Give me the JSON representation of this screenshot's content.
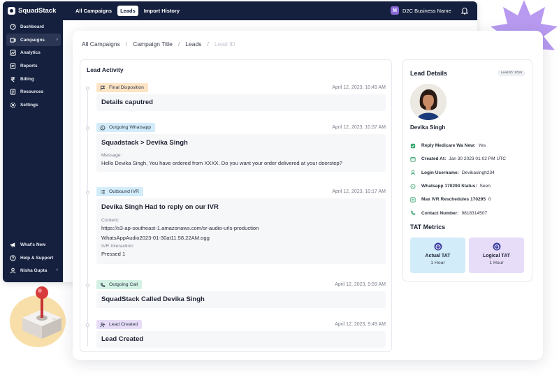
{
  "app": {
    "brand": "SquadStack",
    "top_tabs": [
      "All Campaigns",
      "Leads",
      "Import History"
    ],
    "active_tab": "Leads",
    "business": {
      "badge": "M",
      "name": "D2C Business Name"
    }
  },
  "sidebar": {
    "items": [
      {
        "label": "Dashboard",
        "icon": "dashboard-icon"
      },
      {
        "label": "Campaigns",
        "icon": "campaigns-icon",
        "active": true,
        "chevron": "›"
      },
      {
        "label": "Analytics",
        "icon": "analytics-icon"
      },
      {
        "label": "Reports",
        "icon": "reports-icon"
      },
      {
        "label": "Billing",
        "icon": "rupee-icon"
      },
      {
        "label": "Resources",
        "icon": "resources-icon"
      },
      {
        "label": "Settings",
        "icon": "gear-icon"
      }
    ],
    "bottom": [
      {
        "label": "What's New",
        "icon": "megaphone-icon"
      },
      {
        "label": "Help & Support",
        "icon": "help-icon"
      },
      {
        "label": "Nisha Gupta",
        "icon": "user-icon",
        "chevron": "›"
      }
    ]
  },
  "breadcrumb": [
    "All Campaigns",
    "Campaign Title",
    "Leads",
    "Lead ID"
  ],
  "activity": {
    "title": "Lead Activity",
    "entries": [
      {
        "tag": "Final Disposition",
        "color": "orange",
        "icon": "flag-icon",
        "time": "April 12, 2023, 10:49 AM",
        "headline": "Details caputred"
      },
      {
        "tag": "Outgoing Whatsapp",
        "color": "blue",
        "icon": "whatsapp-icon",
        "time": "April 12, 2023, 10:37 AM",
        "headline": "Squadstack > Devika Singh",
        "label1": "Message:",
        "value1": "Hello Devika Singh, You have ordered from XXXX. Do you want your order delivered at your doorstep?"
      },
      {
        "tag": "Outbound IVR",
        "color": "blue",
        "icon": "ivr-icon",
        "time": "April 12, 2023, 10:17 AM",
        "headline": "Devika Singh Had to reply on our IVR",
        "label1": "Content:",
        "value1a": "https://s3-ap-southeast-1.amazonaws.com/sr-audio-urls-production",
        "value1b": "WhatsAppAudio2023-01-30at11.58.22AM.ogg",
        "label2": "IVR Interaction:",
        "value2": "Pressed 1"
      },
      {
        "tag": "Outgoing Call",
        "color": "green",
        "icon": "phone-icon",
        "time": "April 12, 2023, 9:59 AM",
        "headline": "SquadStack Called Devika Singh"
      },
      {
        "tag": "Lead Created",
        "color": "purple",
        "icon": "lead-icon",
        "time": "April 12, 2023, 9:49 AM",
        "headline": "Lead Created"
      }
    ]
  },
  "details": {
    "title": "Lead Details",
    "lead_id_badge": "Lead ID: 1019",
    "name": "Devika Singh",
    "rows": [
      {
        "key": "Reply Medicare Wa New:",
        "value": "Yes"
      },
      {
        "key": "Created At:",
        "value": "Jan 30 2023 01:02 PM UTC"
      },
      {
        "key": "Login Username:",
        "value": "Devikasingh234"
      },
      {
        "key": "Whatsapp 170294 Status:",
        "value": "Seen"
      },
      {
        "key": "Max IVR Reschedules 170295",
        "value": "0"
      },
      {
        "key": "Contact Number:",
        "value": "9818314507"
      }
    ],
    "tat_title": "TAT Metrics",
    "tat": [
      {
        "label": "Actual TAT",
        "value": "1 Hour"
      },
      {
        "label": "Logical TAT",
        "value": "1 Hour"
      }
    ]
  },
  "colors": {
    "navy": "#14203d",
    "orange_tag": "#fde4c4",
    "blue_tag": "#d2ecfa",
    "green_tag": "#d3f1e4",
    "purple_tag": "#e8ddf8",
    "star": "#b89af0"
  }
}
